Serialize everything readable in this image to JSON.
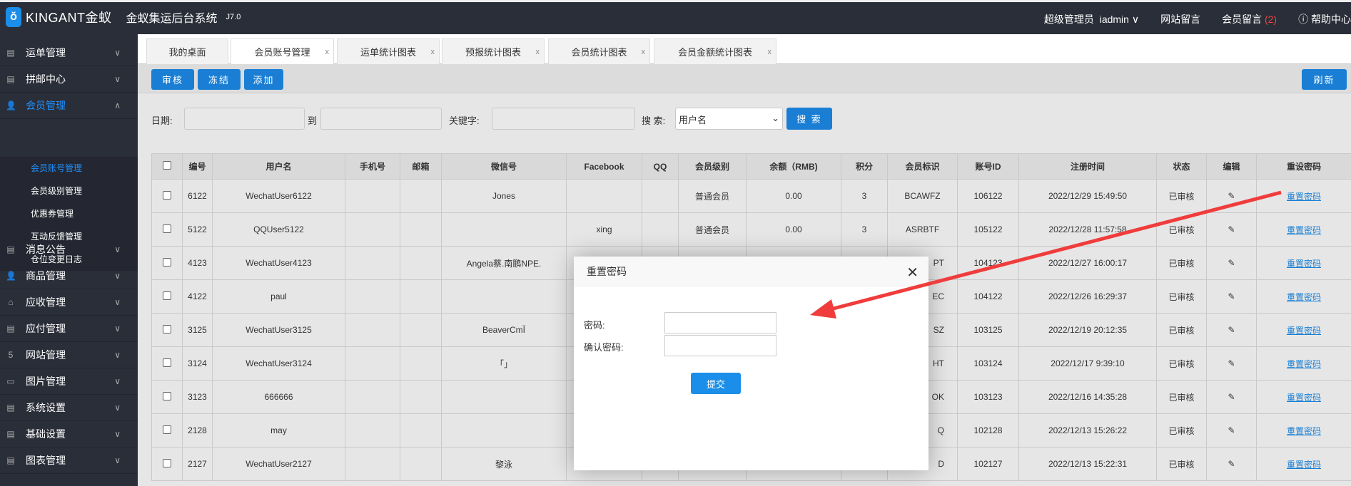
{
  "header": {
    "logo": "KINGANT金蚁",
    "title": "金蚁集运后台系统",
    "version": "J7.0",
    "role": "超级管理员",
    "user": "iadmin ∨",
    "site_msg": "网站留言",
    "member_msg": "会员留言",
    "member_msg_count": "(2)",
    "help": "帮助中心"
  },
  "sidebar": {
    "items": [
      {
        "label": "运单管理",
        "icon": "document-icon"
      },
      {
        "label": "拼邮中心",
        "icon": "document-icon"
      },
      {
        "label": "会员管理",
        "icon": "user-icon"
      },
      {
        "label": "消息公告",
        "icon": "document-icon"
      },
      {
        "label": "商品管理",
        "icon": "user-icon"
      },
      {
        "label": "应收管理",
        "icon": "bank-icon"
      },
      {
        "label": "应付管理",
        "icon": "document-icon"
      },
      {
        "label": "网站管理",
        "icon": "html5-icon"
      },
      {
        "label": "图片管理",
        "icon": "window-icon"
      },
      {
        "label": "系统设置",
        "icon": "document-icon"
      },
      {
        "label": "基础设置",
        "icon": "document-icon"
      },
      {
        "label": "图表管理",
        "icon": "document-icon"
      }
    ],
    "sub": [
      "会员账号管理",
      "会员级别管理",
      "优惠券管理",
      "互动反馈管理",
      "仓位变更日志"
    ]
  },
  "tabs": [
    "我的桌面",
    "会员账号管理",
    "运单统计图表",
    "预报统计图表",
    "会员统计图表",
    "会员金额统计图表"
  ],
  "toolbar": {
    "audit": "审核",
    "freeze": "冻结",
    "add": "添加",
    "refresh": "刷新"
  },
  "search": {
    "date_label": "日期:",
    "to_label": "到",
    "keyword_label": "关键字:",
    "search_label": "搜 索:",
    "field": "用户名",
    "button": "搜 索"
  },
  "table": {
    "headers": [
      "编号",
      "用户名",
      "手机号",
      "邮箱",
      "微信号",
      "Facebook",
      "QQ",
      "会员级别",
      "余额（RMB)",
      "积分",
      "会员标识",
      "账号ID",
      "注册时间",
      "状态",
      "编辑",
      "重设密码"
    ],
    "rows": [
      [
        "6122",
        "WechatUser6122",
        "",
        "",
        "Jones",
        "",
        "",
        "普通会员",
        "0.00",
        "3",
        "BCAWFZ",
        "106122",
        "2022/12/29 15:49:50",
        "已审核",
        "",
        "重置密码"
      ],
      [
        "5122",
        "QQUser5122",
        "",
        "",
        "",
        "xing",
        "",
        "普通会员",
        "0.00",
        "3",
        "ASRBTF",
        "105122",
        "2022/12/28 11:57:58",
        "已审核",
        "",
        "重置密码"
      ],
      [
        "4123",
        "WechatUser4123",
        "",
        "",
        "Angela蔡.南鹏NPE.",
        "",
        "",
        "",
        "",
        "",
        "PT",
        "104123",
        "2022/12/27 16:00:17",
        "已审核",
        "",
        "重置密码"
      ],
      [
        "4122",
        "paul",
        "",
        "",
        "",
        "",
        "",
        "",
        "",
        "",
        "EC",
        "104122",
        "2022/12/26 16:29:37",
        "已审核",
        "",
        "重置密码"
      ],
      [
        "3125",
        "WechatUser3125",
        "",
        "",
        "BeaverCmĬ",
        "",
        "",
        "",
        "",
        "",
        "SZ",
        "103125",
        "2022/12/19 20:12:35",
        "已审核",
        "",
        "重置密码"
      ],
      [
        "3124",
        "WechatUser3124",
        "",
        "",
        "「」",
        "",
        "",
        "",
        "",
        "",
        "HT",
        "103124",
        "2022/12/17 9:39:10",
        "已审核",
        "",
        "重置密码"
      ],
      [
        "3123",
        "666666",
        "",
        "",
        "",
        "",
        "",
        "",
        "",
        "",
        "OK",
        "103123",
        "2022/12/16 14:35:28",
        "已审核",
        "",
        "重置密码"
      ],
      [
        "2128",
        "may",
        "",
        "",
        "",
        "",
        "",
        "",
        "",
        "",
        "Q",
        "102128",
        "2022/12/13 15:26:22",
        "已审核",
        "",
        "重置密码"
      ],
      [
        "2127",
        "WechatUser2127",
        "",
        "",
        "黎泳",
        "",
        "",
        "",
        "",
        "",
        "D",
        "102127",
        "2022/12/13 15:22:31",
        "已审核",
        "",
        "重置密码"
      ]
    ]
  },
  "modal": {
    "title": "重置密码",
    "password_label": "密码:",
    "confirm_label": "确认密码:",
    "submit": "提交"
  },
  "colors": {
    "accent": "#1a7fd4",
    "sidebar": "#2a2e38",
    "annotation_arrow": "#f03c3c"
  }
}
